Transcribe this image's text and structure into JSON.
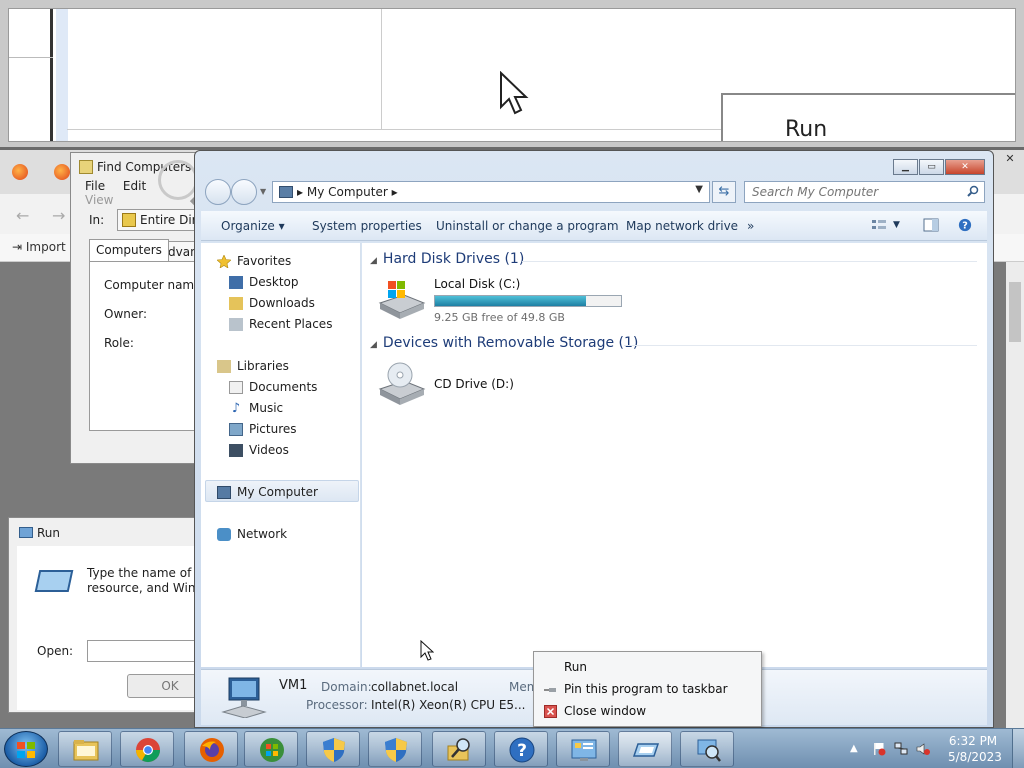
{
  "zoom": {
    "run_label": "Run"
  },
  "browser": {
    "import_label": "Import"
  },
  "find_computers": {
    "title": "Find Computers",
    "menu": [
      "File",
      "Edit",
      "View"
    ],
    "in_label": "In:",
    "in_value": "Entire Direct",
    "tabs": [
      "Computers",
      "Advance"
    ],
    "fields": [
      "Computer name:",
      "Owner:",
      "Role:"
    ]
  },
  "run_dialog": {
    "title": "Run",
    "description_line1": "Type the name of a pr",
    "description_line2": "resource, and Window",
    "open_label": "Open:",
    "open_value": "",
    "ok_label": "OK"
  },
  "explorer": {
    "address_crumb": "My Computer",
    "search_placeholder": "Search My Computer",
    "commands": {
      "organize": "Organize",
      "system_properties": "System properties",
      "uninstall": "Uninstall or change a program",
      "map_drive": "Map network drive",
      "more": "»"
    },
    "nav": {
      "favorites": "Favorites",
      "desktop": "Desktop",
      "downloads": "Downloads",
      "recent_places": "Recent Places",
      "libraries": "Libraries",
      "documents": "Documents",
      "music": "Music",
      "pictures": "Pictures",
      "videos": "Videos",
      "my_computer": "My Computer",
      "network": "Network"
    },
    "groups": {
      "hdd_header": "Hard Disk Drives (1)",
      "removable_header": "Devices with Removable Storage (1)"
    },
    "drives": {
      "c_name": "Local Disk (C:)",
      "c_free": "9.25 GB free of 49.8 GB",
      "c_used_fraction": 0.81,
      "d_name": "CD Drive (D:)"
    },
    "details": {
      "computer_name": "VM1",
      "domain_label": "Domain:",
      "domain_value": "collabnet.local",
      "processor_label": "Processor:",
      "processor_value": "Intel(R) Xeon(R) CPU E5...",
      "memory_label": "Mem"
    }
  },
  "context_menu": {
    "items": [
      "Run",
      "Pin this program to taskbar",
      "Close window"
    ]
  },
  "taskbar": {
    "buttons": [
      "file-explorer",
      "chrome",
      "firefox",
      "windows-xp-mode",
      "uac-shield",
      "uac-shield",
      "search-computers",
      "help",
      "control-panel",
      "run",
      "find-computers"
    ],
    "time": "6:32 PM",
    "date": "5/8/2023"
  },
  "colors": {
    "accent": "#1e3c78",
    "taskbar": "#7f9dbd",
    "drive_fill": "#1e7fa3"
  }
}
